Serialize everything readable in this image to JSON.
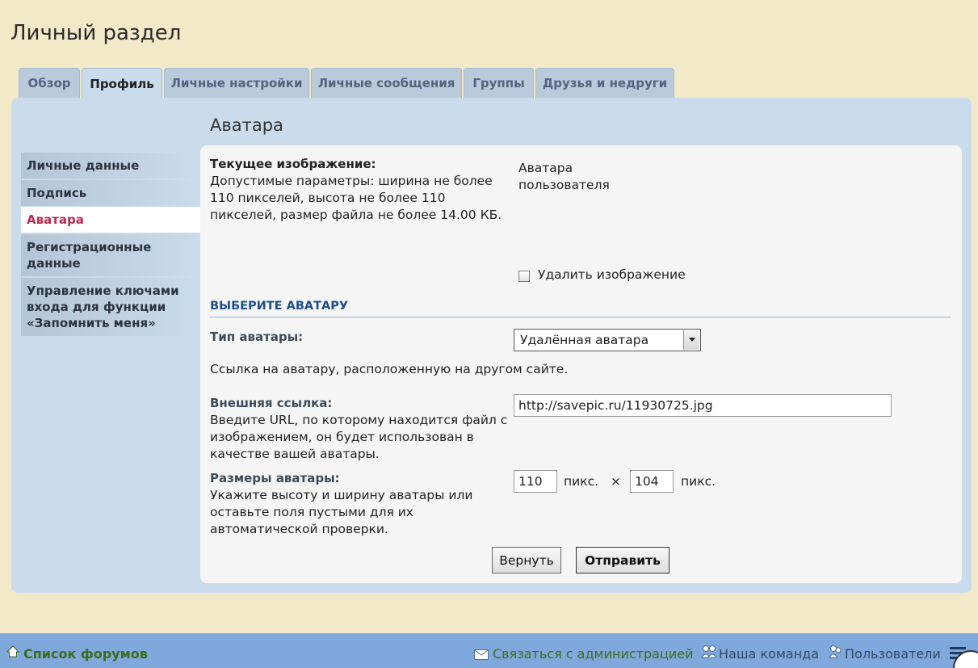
{
  "page": {
    "title": "Личный раздел"
  },
  "tabs": [
    {
      "label": "Обзор"
    },
    {
      "label": "Профиль",
      "active": true
    },
    {
      "label": "Личные настройки"
    },
    {
      "label": "Личные сообщения"
    },
    {
      "label": "Группы"
    },
    {
      "label": "Друзья и недруги"
    }
  ],
  "section": {
    "title": "Аватара"
  },
  "sidebar": {
    "items": [
      {
        "label": "Личные данные"
      },
      {
        "label": "Подпись"
      },
      {
        "label": "Аватара",
        "active": true
      },
      {
        "label": "Регистрационные данные"
      },
      {
        "label": "Управление ключами входа для функции «Запомнить меня»"
      }
    ]
  },
  "current_image": {
    "label": "Текущее изображение:",
    "description": "Допустимые параметры: ширина не более 110 пикселей, высота не более 110 пикселей, размер файла не более 14.00 КБ.",
    "placeholder_alt": "Аватара пользователя",
    "delete_label": "Удалить изображение",
    "delete_checked": false
  },
  "choose": {
    "heading": "ВЫБЕРИТЕ АВАТАРУ",
    "type_label": "Тип аватары:",
    "type_value": "Удалённая аватара",
    "type_hint": "Ссылка на аватару, расположенную на другом сайте.",
    "url_label": "Внешняя ссылка:",
    "url_hint": "Введите URL, по которому находится файл с изображением, он будет использован в качестве вашей аватары.",
    "url_value": "http://savepic.ru/11930725.jpg",
    "size_label": "Размеры аватары:",
    "size_hint": "Укажите высоту и ширину аватары или оставьте поля пустыми для их автоматической проверки.",
    "width_value": "110",
    "height_value": "104",
    "unit": "пикс.",
    "times": "×"
  },
  "buttons": {
    "reset": "Вернуть",
    "submit": "Отправить"
  },
  "footer": {
    "forum_list": "Список форумов",
    "contact": "Связаться с администрацией",
    "team": "Наша команда",
    "users": "Пользователи"
  },
  "colors": {
    "page_bg": "#f2e9c9",
    "panel_bg": "#cadceb",
    "footer_bg": "#7fa8dc",
    "link_green": "#3a6e1e",
    "active_red": "#bc2a4d",
    "heading_blue": "#1c4f8a"
  },
  "icons": {
    "home": "home-icon",
    "contact": "envelope-icon",
    "team": "team-icon",
    "users": "users-icon",
    "menu": "hamburger-icon",
    "select_arrow": "chevron-down-icon"
  }
}
